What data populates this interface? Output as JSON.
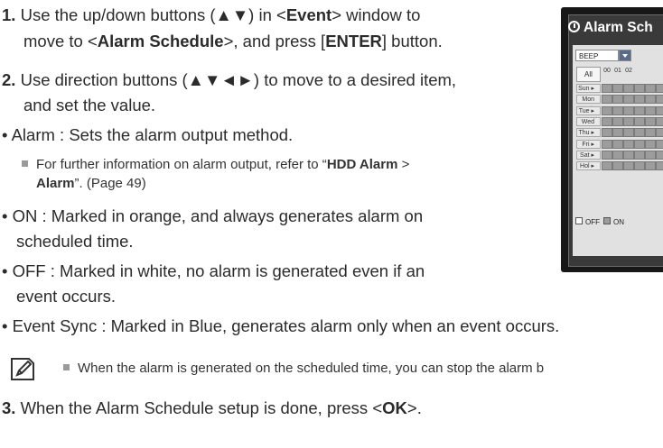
{
  "steps": {
    "step1_num": "1.",
    "step1_a": "Use the up/down buttons (▲▼) in <",
    "step1_event": "Event",
    "step1_b": "> window to",
    "step1_line2_a": "move to <",
    "step1_alarm_schedule": "Alarm Schedule",
    "step1_line2_b": ">, and press [",
    "step1_enter": "ENTER",
    "step1_line2_c": "] button.",
    "step2_num": "2.",
    "step2_line1": "Use direction buttons (▲▼◄►) to move to a desired item,",
    "step2_line2": "and set the value.",
    "step3_num": "3.",
    "step3_a": "When the Alarm Schedule setup is done, press <",
    "step3_ok": "OK",
    "step3_b": ">."
  },
  "bullets": {
    "alarm": "• Alarm : Sets the alarm output method.",
    "alarm_note_a": "For further information on alarm output, refer to “",
    "alarm_note_bold1": "HDD Alarm",
    "alarm_note_gt": " >",
    "alarm_note_bold2": "Alarm",
    "alarm_note_b": "”. (Page 49)",
    "on_line1": "• ON : Marked in orange, and always generates alarm on",
    "on_line2": "scheduled time.",
    "off_line1": "• OFF : Marked in white, no alarm is generated even if an",
    "off_line2": "event occurs.",
    "event_sync": "• Event Sync : Marked in Blue, generates alarm only when an event occurs."
  },
  "note": {
    "text": "When the alarm is generated on the scheduled time, you can stop the alarm b",
    "icon": "note-pencil-icon"
  },
  "screen": {
    "title": "Alarm Sch",
    "dropdown_value": "BEEP",
    "all_label": "All",
    "hours": [
      "00",
      "01",
      "02"
    ],
    "days": [
      "Sun",
      "Mon",
      "Tue",
      "Wed",
      "Thu",
      "Fri",
      "Sat",
      "Hol"
    ],
    "legend_off": "OFF",
    "legend_on": "ON"
  },
  "colors": {
    "screen_bg": "#171717",
    "window_bg": "#3a3a3a",
    "cell_on": "#9c9c9c"
  }
}
